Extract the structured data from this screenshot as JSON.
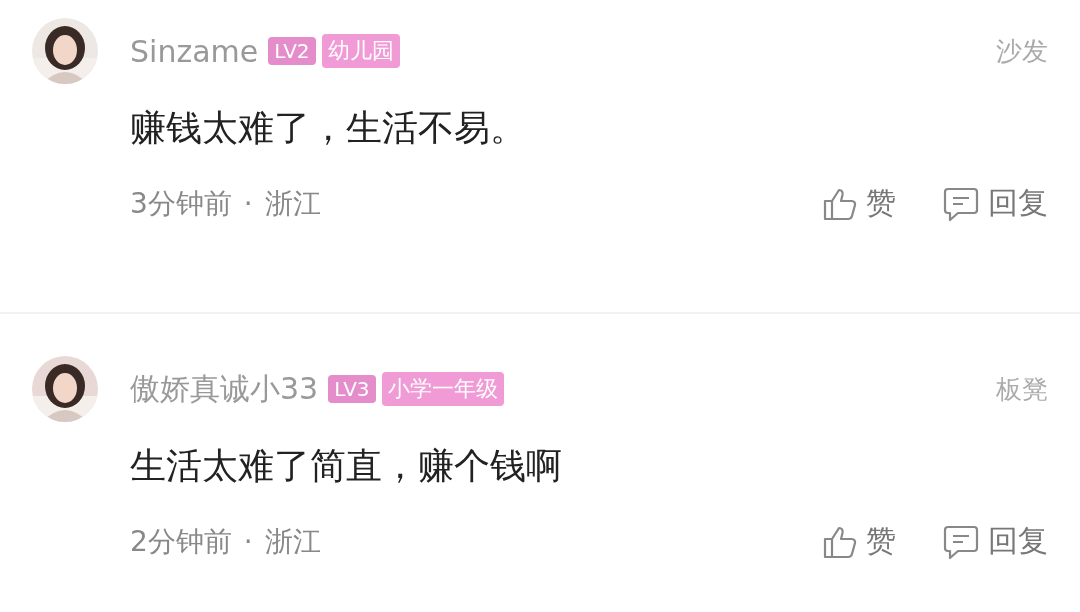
{
  "comments": [
    {
      "username": "Sinzame",
      "level": "LV2",
      "rank": "幼儿园",
      "floor": "沙发",
      "text": "赚钱太难了，生活不易。",
      "time": "3分钟前",
      "separator": "·",
      "location": "浙江",
      "like_label": "赞",
      "reply_label": "回复"
    },
    {
      "username": "傲娇真诚小33",
      "level": "LV3",
      "rank": "小学一年级",
      "floor": "板凳",
      "text": "生活太难了简直，赚个钱啊",
      "time": "2分钟前",
      "separator": "·",
      "location": "浙江",
      "like_label": "赞",
      "reply_label": "回复"
    }
  ]
}
